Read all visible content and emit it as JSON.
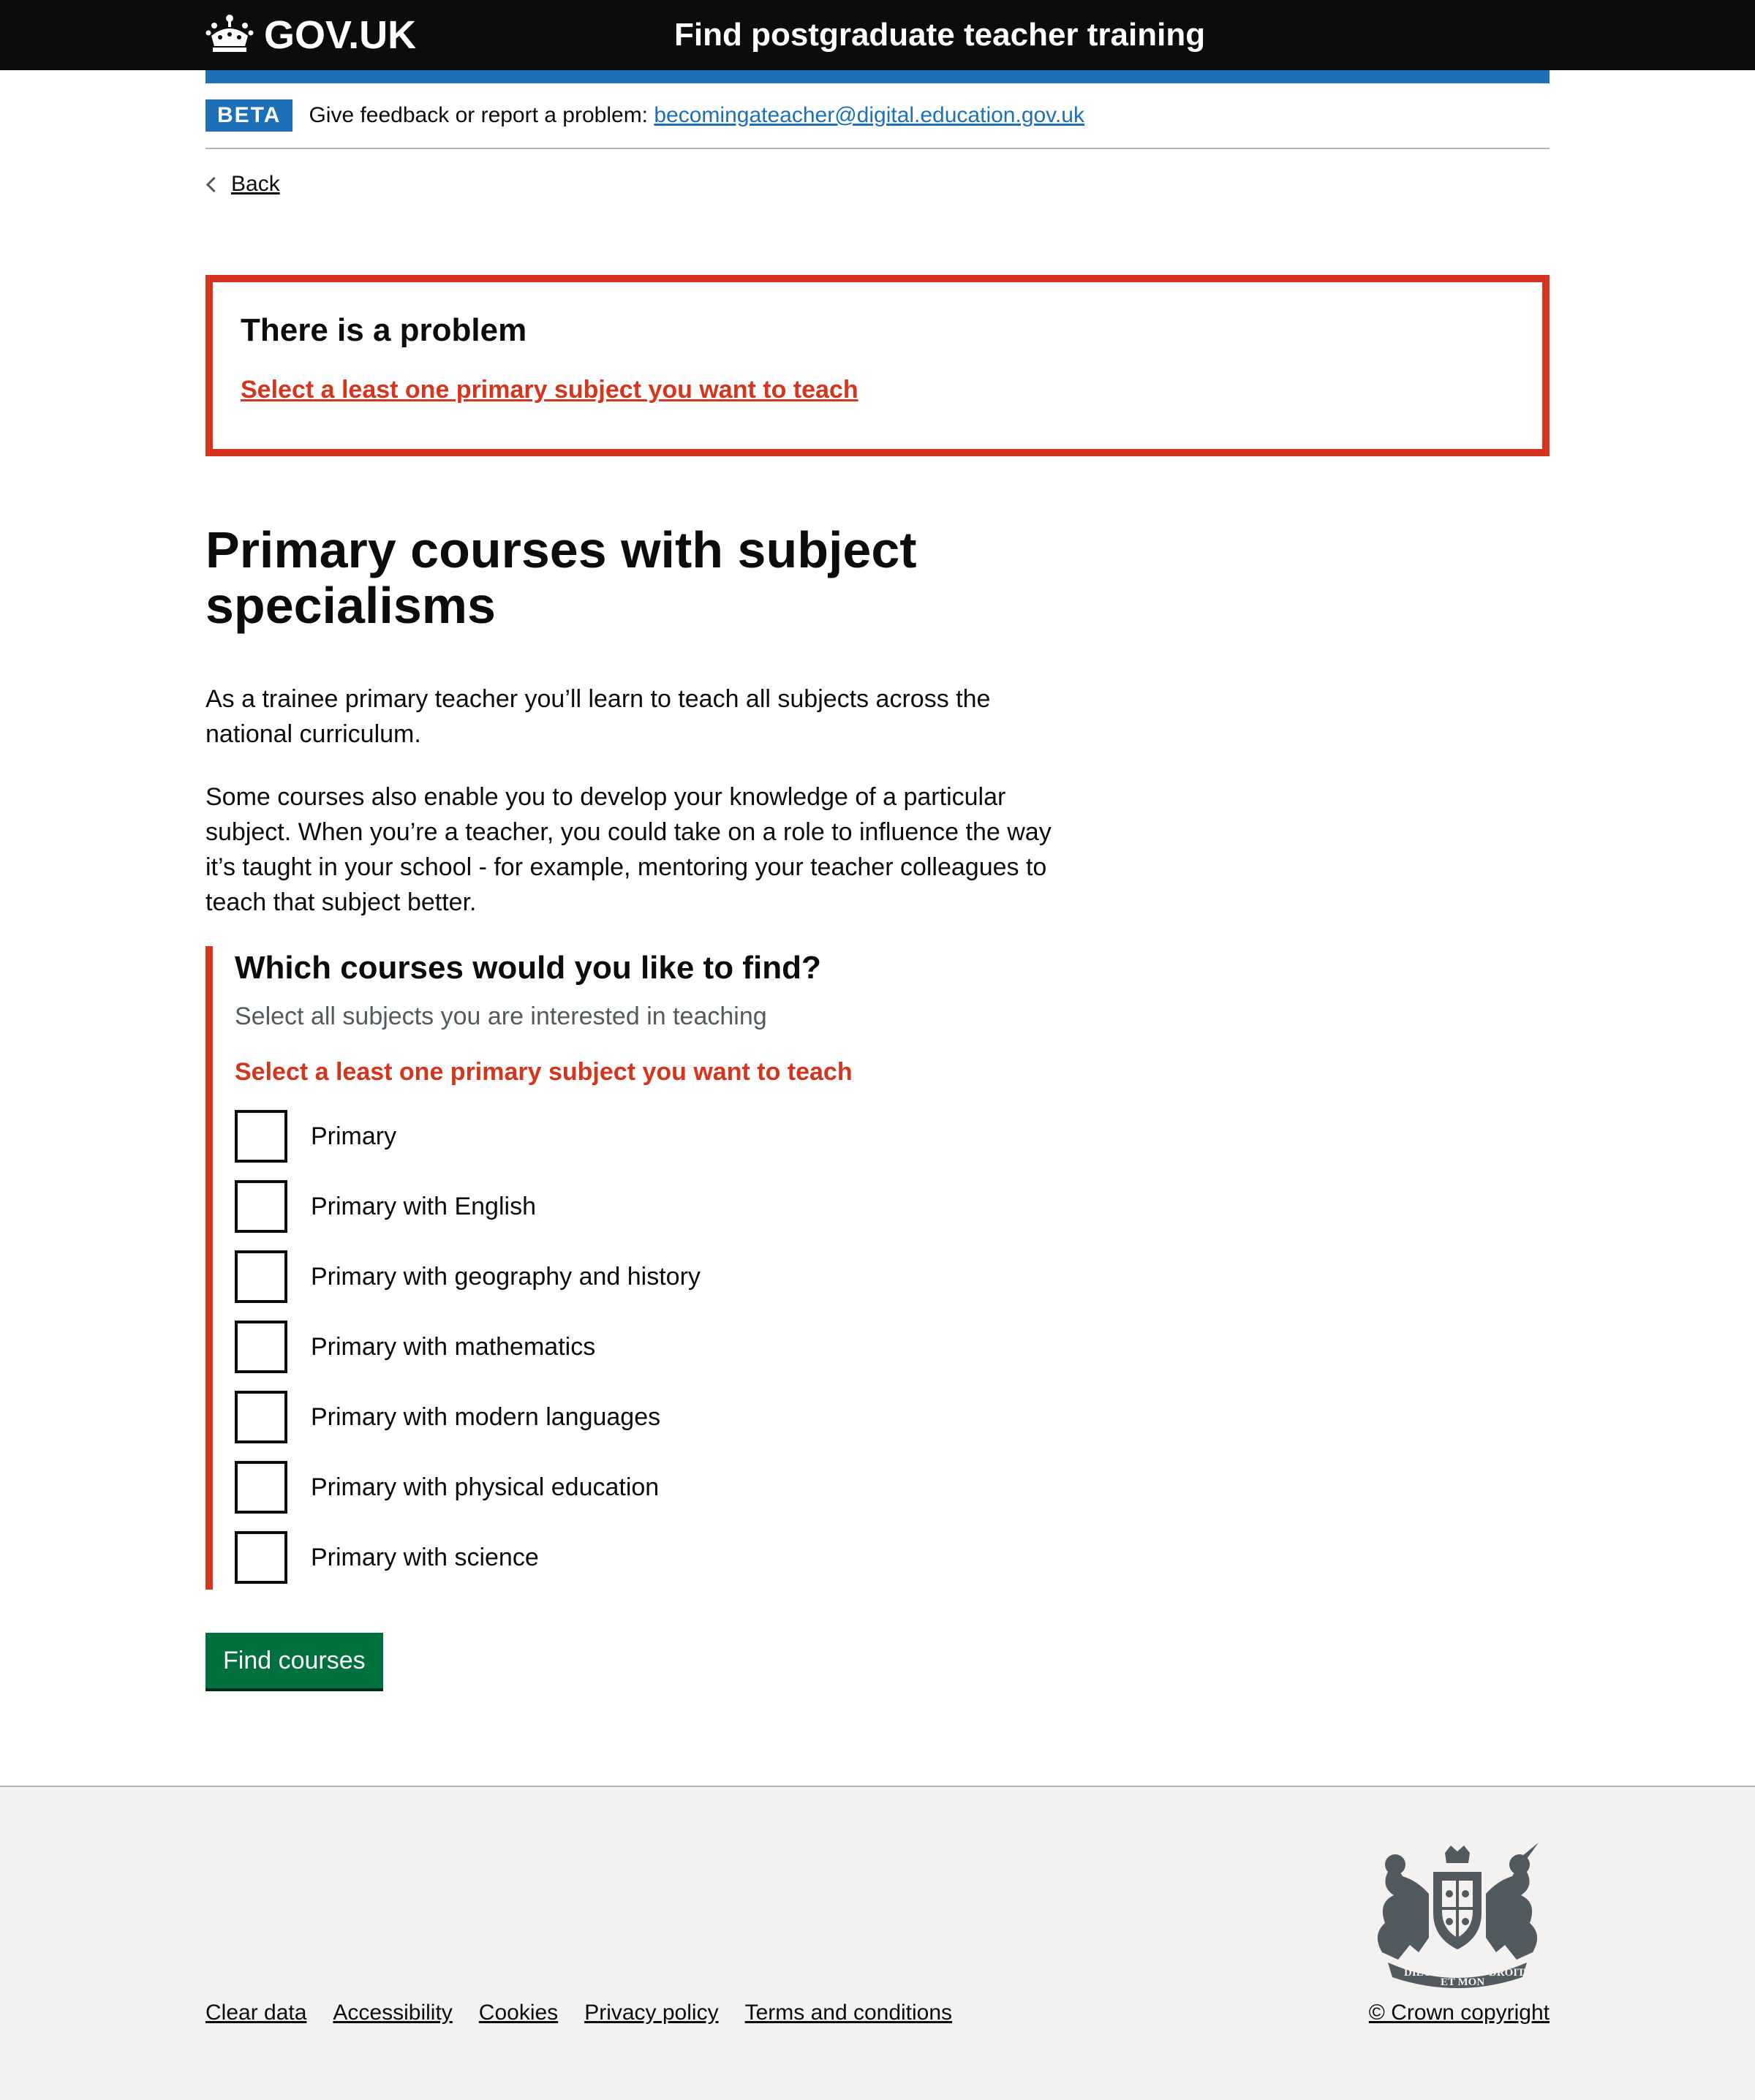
{
  "header": {
    "logo_text": "GOV.UK",
    "service_name": "Find postgraduate teacher training"
  },
  "phase_banner": {
    "tag": "BETA",
    "text": "Give feedback or report a problem:",
    "link": "becomingateacher@digital.education.gov.uk"
  },
  "back": {
    "label": "Back"
  },
  "error_summary": {
    "title": "There is a problem",
    "link": "Select a least one primary subject you want to teach"
  },
  "main": {
    "heading_line1": "Primary courses with subject",
    "heading_line2": "specialisms",
    "para1_line1": "As a trainee primary teacher you’ll learn to teach all subjects across the",
    "para1_line2": "national curriculum.",
    "para2_line1": "Some courses also enable you to develop your knowledge of a particular",
    "para2_line2": "subject. When you’re a teacher, you could take on a role to influence the way",
    "para2_line3": "it’s taught in your school - for example, mentoring your teacher colleagues to",
    "para2_line4": "teach that subject better."
  },
  "form": {
    "legend": "Which courses would you like to find?",
    "hint": "Select all subjects you are interested in teaching",
    "error": "Select a least one primary subject you want to teach",
    "options": [
      "Primary",
      "Primary with English",
      "Primary with geography and history",
      "Primary with mathematics",
      "Primary with modern languages",
      "Primary with physical education",
      "Primary with science"
    ],
    "submit": "Find courses"
  },
  "footer": {
    "links": [
      "Clear data",
      "Accessibility",
      "Cookies",
      "Privacy policy",
      "Terms and conditions"
    ],
    "copyright": "© Crown copyright",
    "crest_motto_left": "DIEU",
    "crest_motto_center": "ET MON",
    "crest_motto_right": "DROIT"
  },
  "colors": {
    "header_bg": "#0b0c0c",
    "brand_blue": "#1d70b8",
    "error_red": "#d4351c",
    "button_green": "#00703c",
    "footer_bg": "#f3f2f1"
  },
  "icons": [
    "crown-icon",
    "chevron-left-icon",
    "royal-coat-of-arms"
  ]
}
